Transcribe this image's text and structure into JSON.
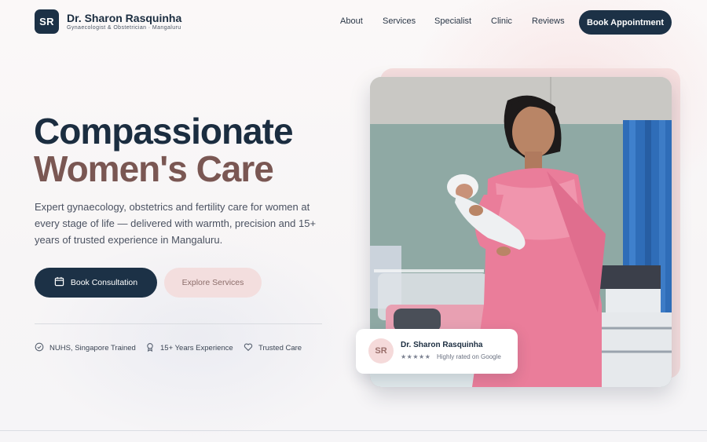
{
  "header": {
    "logo_initials": "SR",
    "brand_name": "Dr. Sharon Rasquinha",
    "brand_subtitle": "Gynaecologist & Obstetrician · Mangaluru",
    "nav": [
      "About",
      "Services",
      "Specialist",
      "Clinic",
      "Reviews"
    ],
    "cta": "Book Appointment"
  },
  "hero": {
    "title_line1": "Compassionate",
    "title_line2": "Women's Care",
    "description": "Expert gynaecology, obstetrics and fertility care for women at every stage of life — delivered with warmth, precision and 15+ years of trusted experience in Mangaluru.",
    "primary_cta": "Book Consultation",
    "secondary_cta": "Explore Services",
    "trust": [
      "NUHS, Singapore Trained",
      "15+ Years Experience",
      "Trusted Care"
    ]
  },
  "badge": {
    "initials": "SR",
    "name": "Dr. Sharon Rasquinha",
    "stars": "★★★★★",
    "rating_text": "Highly rated on Google"
  },
  "colors": {
    "navy": "#1c3146",
    "accent_brown": "#7a5753",
    "blush": "#f3dede"
  },
  "icons": {
    "consultation": "calendar-icon",
    "trust": [
      "check-circle-icon",
      "award-icon",
      "heart-icon"
    ]
  }
}
